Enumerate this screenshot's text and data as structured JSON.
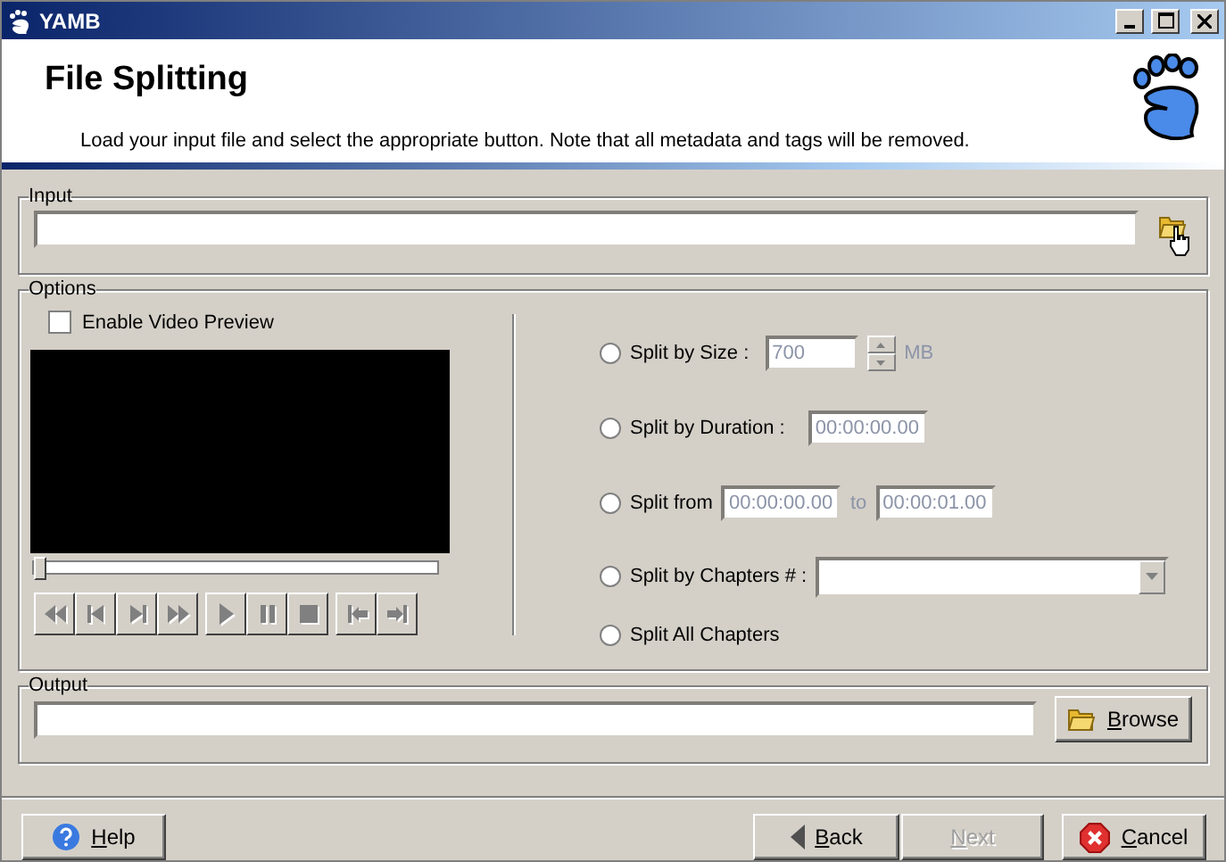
{
  "window": {
    "title": "YAMB"
  },
  "header": {
    "title": "File Splitting",
    "description": "Load your input file and select the appropriate button. Note that all metadata and tags will be removed."
  },
  "input": {
    "label": "Input"
  },
  "options": {
    "label": "Options",
    "video_preview": {
      "label": "Enable Video Preview",
      "checked": false
    },
    "seek": {
      "level": 0
    },
    "split_modes": [
      {
        "kind": "size",
        "label": "Split by Size :",
        "selected": false,
        "value": "700",
        "unit": "MB",
        "disabled": true
      },
      {
        "kind": "duration",
        "label": "Split by Duration :",
        "selected": false,
        "value": "00:00:00.00",
        "disabled": true
      },
      {
        "kind": "range",
        "label": "Split from",
        "selected": false,
        "from": "00:00:00.00",
        "to_label": "to",
        "to": "00:00:01.00",
        "disabled": true
      },
      {
        "kind": "chapters",
        "label": "Split by Chapters # :",
        "selected": false
      },
      {
        "kind": "all",
        "label": "Split All Chapters",
        "selected": false
      }
    ]
  },
  "output": {
    "label": "Output",
    "browse": "Browse"
  },
  "buttons": [
    {
      "kind": "help",
      "label": "Help",
      "disabled": false
    },
    {
      "kind": "back",
      "label": "Back",
      "disabled": false
    },
    {
      "kind": "next",
      "label": "Next",
      "disabled": true
    },
    {
      "kind": "cancel",
      "label": "Cancel",
      "disabled": false
    }
  ]
}
